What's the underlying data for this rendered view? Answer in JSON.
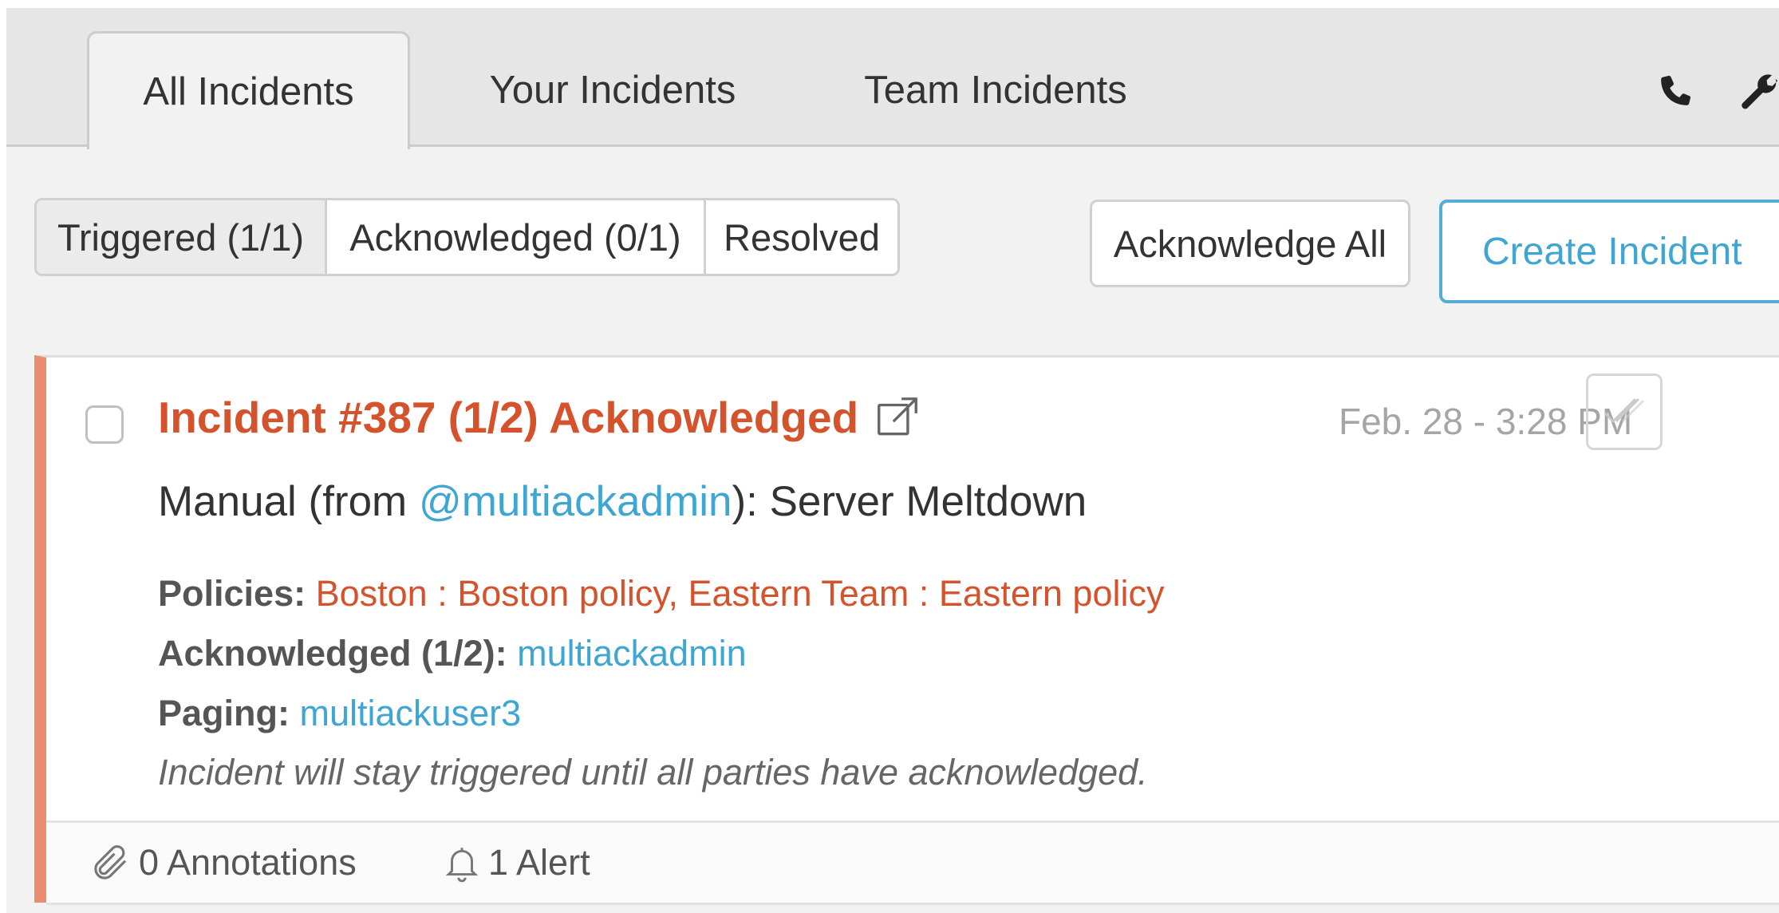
{
  "tabs": {
    "all": "All Incidents",
    "your": "Your Incidents",
    "team": "Team Incidents",
    "active": "all"
  },
  "toolbar_icons": [
    "phone-icon",
    "wrench-icon"
  ],
  "filters": {
    "triggered": "Triggered (1/1)",
    "acknowledged": "Acknowledged (0/1)",
    "resolved": "Resolved",
    "active": "triggered"
  },
  "actions": {
    "acknowledge_all": "Acknowledge All",
    "create_incident": "Create Incident"
  },
  "incident": {
    "title": "Incident #387 (1/2) Acknowledged",
    "timestamp": "Feb. 28 - 3:28 PM",
    "summary_prefix": "Manual (from ",
    "summary_user": "@multiackadmin",
    "summary_suffix": "): Server Meltdown",
    "policies_label": "Policies:",
    "policies_value": "Boston : Boston policy, Eastern Team : Eastern policy",
    "acknowledged_label": "Acknowledged (1/2):",
    "acknowledged_value": "multiackadmin",
    "paging_label": "Paging:",
    "paging_value": "multiackuser3",
    "note": "Incident will stay triggered until all parties have acknowledged.",
    "annotations": "0 Annotations",
    "alerts": "1 Alert"
  },
  "colors": {
    "incident_accent": "#d5532c",
    "card_border": "#ea8c6f",
    "link": "#3fa5d3",
    "primary_button": "#55acd5"
  }
}
